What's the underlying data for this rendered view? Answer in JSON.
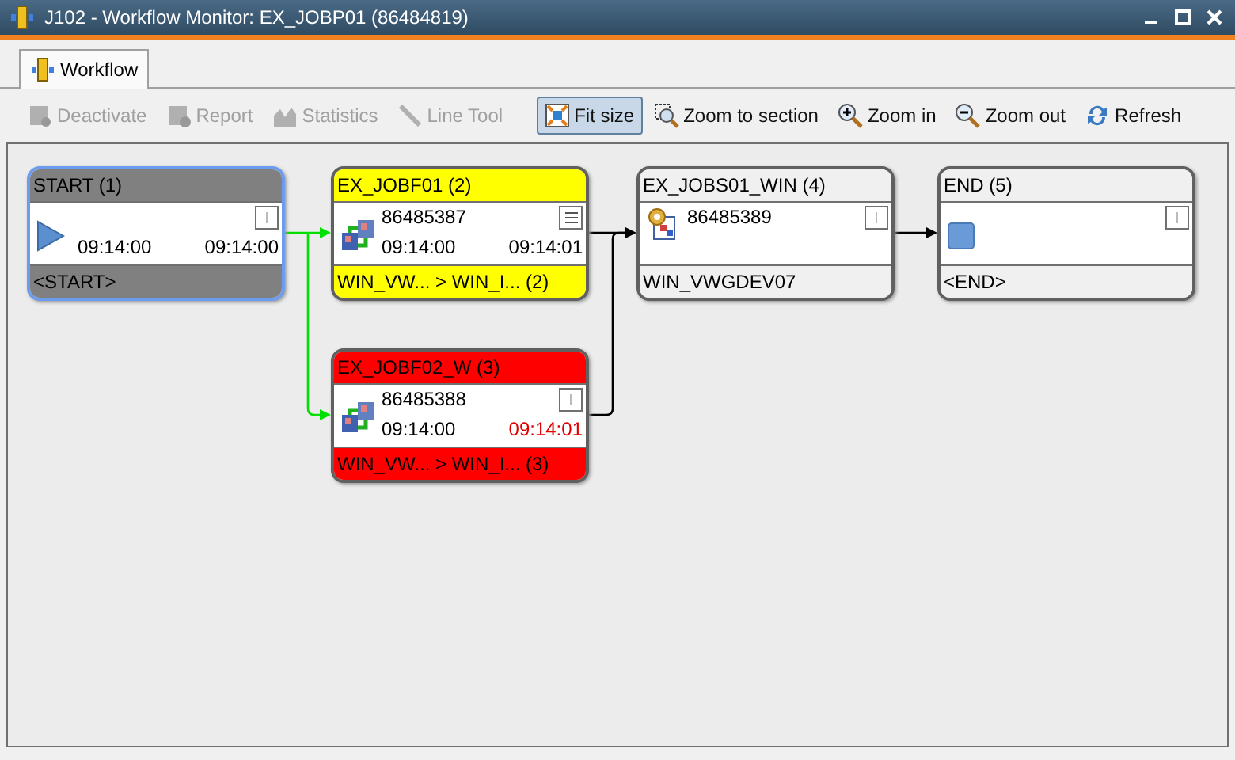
{
  "window": {
    "title": "J102 - Workflow Monitor: EX_JOBP01 (86484819)"
  },
  "tabs": [
    {
      "label": "Workflow",
      "selected": true
    }
  ],
  "toolbar": [
    {
      "label": "Deactivate",
      "disabled": true,
      "selected": false
    },
    {
      "label": "Report",
      "disabled": true,
      "selected": false
    },
    {
      "label": "Statistics",
      "disabled": true,
      "selected": false
    },
    {
      "label": "Line Tool",
      "disabled": true,
      "selected": false
    },
    {
      "label": "Fit size",
      "disabled": false,
      "selected": true
    },
    {
      "label": "Zoom to section",
      "disabled": false,
      "selected": false
    },
    {
      "label": "Zoom in",
      "disabled": false,
      "selected": false
    },
    {
      "label": "Zoom out",
      "disabled": false,
      "selected": false
    },
    {
      "label": "Refresh",
      "disabled": false,
      "selected": false
    }
  ],
  "nodes": [
    {
      "kind": "start",
      "title": "START (1)",
      "color": "#808080",
      "selected": true,
      "start_time": "09:14:00",
      "end_time": "09:14:00",
      "late": false,
      "footer": "<START>"
    },
    {
      "kind": "workflow_job",
      "title": "EX_JOBF01 (2)",
      "color": "#ffff00",
      "selected": false,
      "run_id": "86485387",
      "start_time": "09:14:00",
      "end_time": "09:14:01",
      "late": false,
      "footer": "WIN_VW... > WIN_I... (2)"
    },
    {
      "kind": "workflow_job",
      "title": "EX_JOBF02_W (3)",
      "color": "#ff0000",
      "selected": false,
      "run_id": "86485388",
      "start_time": "09:14:00",
      "end_time": "09:14:01",
      "late": true,
      "footer": "WIN_VW... > WIN_I... (3)"
    },
    {
      "kind": "job",
      "title": "EX_JOBS01_WIN (4)",
      "color": "#f0f0f0",
      "selected": false,
      "run_id": "86485389",
      "footer": "WIN_VWGDEV07"
    },
    {
      "kind": "end",
      "title": "END (5)",
      "color": "#f0f0f0",
      "selected": false,
      "footer": "<END>"
    }
  ],
  "connections": [
    {
      "color": "#00e000"
    },
    {
      "color": "#00e000"
    },
    {
      "color": "#000000"
    },
    {
      "color": "#000000"
    },
    {
      "color": "#000000"
    }
  ]
}
